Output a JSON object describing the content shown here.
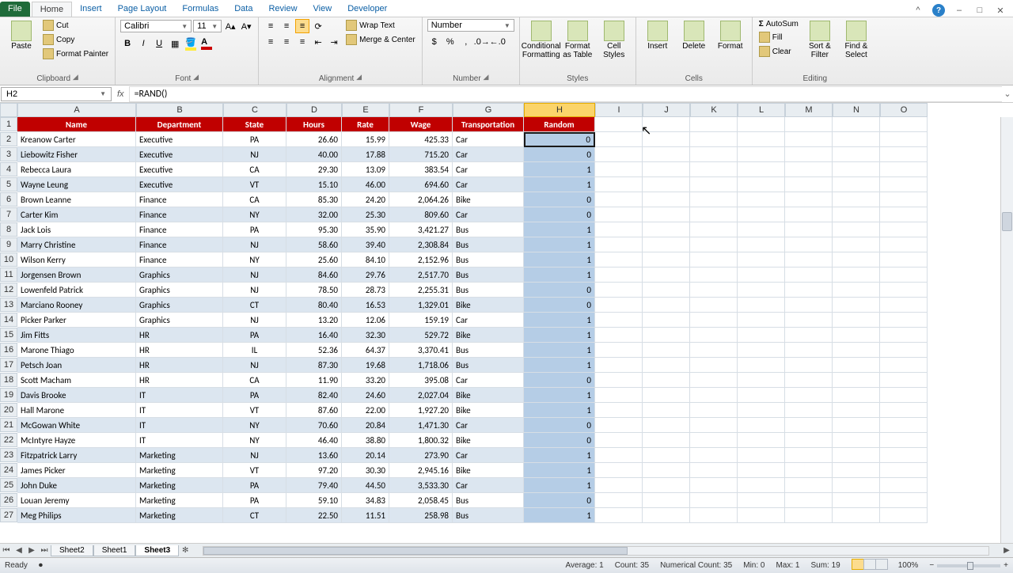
{
  "tabs": [
    "File",
    "Home",
    "Insert",
    "Page Layout",
    "Formulas",
    "Data",
    "Review",
    "View",
    "Developer"
  ],
  "active_tab": "Home",
  "clipboard": {
    "paste": "Paste",
    "cut": "Cut",
    "copy": "Copy",
    "painter": "Format Painter",
    "group": "Clipboard"
  },
  "font": {
    "name": "Calibri",
    "size": "11",
    "group": "Font"
  },
  "alignment": {
    "wrap": "Wrap Text",
    "merge": "Merge & Center",
    "group": "Alignment"
  },
  "number": {
    "format": "Number",
    "group": "Number"
  },
  "styles": {
    "cond": "Conditional Formatting",
    "tbl": "Format as Table",
    "cell": "Cell Styles",
    "group": "Styles"
  },
  "cells": {
    "insert": "Insert",
    "delete": "Delete",
    "format": "Format",
    "group": "Cells"
  },
  "editing": {
    "sum": "AutoSum",
    "fill": "Fill",
    "clear": "Clear",
    "sort": "Sort & Filter",
    "find": "Find & Select",
    "group": "Editing"
  },
  "namebox": "H2",
  "formula": "=RAND()",
  "columns": [
    "A",
    "B",
    "C",
    "D",
    "E",
    "F",
    "G",
    "H",
    "I",
    "J",
    "K",
    "L",
    "M",
    "N",
    "O"
  ],
  "selected_col_idx": 7,
  "headers": [
    "Name",
    "Department",
    "State",
    "Hours",
    "Rate",
    "Wage",
    "Transportation",
    "Random"
  ],
  "rows": [
    {
      "n": 2,
      "d": [
        "Kreanow Carter",
        "Executive",
        "PA",
        "26.60",
        "15.99",
        "425.33",
        "Car",
        "0"
      ]
    },
    {
      "n": 3,
      "d": [
        "Liebowitz Fisher",
        "Executive",
        "NJ",
        "40.00",
        "17.88",
        "715.20",
        "Car",
        "0"
      ]
    },
    {
      "n": 4,
      "d": [
        "Rebecca Laura",
        "Executive",
        "CA",
        "29.30",
        "13.09",
        "383.54",
        "Car",
        "1"
      ]
    },
    {
      "n": 5,
      "d": [
        "Wayne Leung",
        "Executive",
        "VT",
        "15.10",
        "46.00",
        "694.60",
        "Car",
        "1"
      ]
    },
    {
      "n": 6,
      "d": [
        "Brown Leanne",
        "Finance",
        "CA",
        "85.30",
        "24.20",
        "2,064.26",
        "Bike",
        "0"
      ]
    },
    {
      "n": 7,
      "d": [
        "Carter Kim",
        "Finance",
        "NY",
        "32.00",
        "25.30",
        "809.60",
        "Car",
        "0"
      ]
    },
    {
      "n": 8,
      "d": [
        "Jack Lois",
        "Finance",
        "PA",
        "95.30",
        "35.90",
        "3,421.27",
        "Bus",
        "1"
      ]
    },
    {
      "n": 9,
      "d": [
        "Marry Christine",
        "Finance",
        "NJ",
        "58.60",
        "39.40",
        "2,308.84",
        "Bus",
        "1"
      ]
    },
    {
      "n": 10,
      "d": [
        "Wilson Kerry",
        "Finance",
        "NY",
        "25.60",
        "84.10",
        "2,152.96",
        "Bus",
        "1"
      ]
    },
    {
      "n": 11,
      "d": [
        "Jorgensen Brown",
        "Graphics",
        "NJ",
        "84.60",
        "29.76",
        "2,517.70",
        "Bus",
        "1"
      ]
    },
    {
      "n": 12,
      "d": [
        "Lowenfeld Patrick",
        "Graphics",
        "NJ",
        "78.50",
        "28.73",
        "2,255.31",
        "Bus",
        "0"
      ]
    },
    {
      "n": 13,
      "d": [
        "Marciano Rooney",
        "Graphics",
        "CT",
        "80.40",
        "16.53",
        "1,329.01",
        "Bike",
        "0"
      ]
    },
    {
      "n": 14,
      "d": [
        "Picker Parker",
        "Graphics",
        "NJ",
        "13.20",
        "12.06",
        "159.19",
        "Car",
        "1"
      ]
    },
    {
      "n": 15,
      "d": [
        "Jim Fitts",
        "HR",
        "PA",
        "16.40",
        "32.30",
        "529.72",
        "Bike",
        "1"
      ]
    },
    {
      "n": 16,
      "d": [
        "Marone Thiago",
        "HR",
        "IL",
        "52.36",
        "64.37",
        "3,370.41",
        "Bus",
        "1"
      ]
    },
    {
      "n": 17,
      "d": [
        "Petsch Joan",
        "HR",
        "NJ",
        "87.30",
        "19.68",
        "1,718.06",
        "Bus",
        "1"
      ]
    },
    {
      "n": 18,
      "d": [
        "Scott Macham",
        "HR",
        "CA",
        "11.90",
        "33.20",
        "395.08",
        "Car",
        "0"
      ]
    },
    {
      "n": 19,
      "d": [
        "Davis Brooke",
        "IT",
        "PA",
        "82.40",
        "24.60",
        "2,027.04",
        "Bike",
        "1"
      ]
    },
    {
      "n": 20,
      "d": [
        "Hall Marone",
        "IT",
        "VT",
        "87.60",
        "22.00",
        "1,927.20",
        "Bike",
        "1"
      ]
    },
    {
      "n": 21,
      "d": [
        "McGowan White",
        "IT",
        "NY",
        "70.60",
        "20.84",
        "1,471.30",
        "Car",
        "0"
      ]
    },
    {
      "n": 22,
      "d": [
        "McIntyre Hayze",
        "IT",
        "NY",
        "46.40",
        "38.80",
        "1,800.32",
        "Bike",
        "0"
      ]
    },
    {
      "n": 23,
      "d": [
        "Fitzpatrick Larry",
        "Marketing",
        "NJ",
        "13.60",
        "20.14",
        "273.90",
        "Car",
        "1"
      ]
    },
    {
      "n": 24,
      "d": [
        "James Picker",
        "Marketing",
        "VT",
        "97.20",
        "30.30",
        "2,945.16",
        "Bike",
        "1"
      ]
    },
    {
      "n": 25,
      "d": [
        "John Duke",
        "Marketing",
        "PA",
        "79.40",
        "44.50",
        "3,533.30",
        "Car",
        "1"
      ]
    },
    {
      "n": 26,
      "d": [
        "Louan Jeremy",
        "Marketing",
        "PA",
        "59.10",
        "34.83",
        "2,058.45",
        "Bus",
        "0"
      ]
    },
    {
      "n": 27,
      "d": [
        "Meg Philips",
        "Marketing",
        "CT",
        "22.50",
        "11.51",
        "258.98",
        "Bus",
        "1"
      ]
    }
  ],
  "num_cols": [
    3,
    4,
    5,
    7
  ],
  "center_cols": [
    2
  ],
  "sheets": [
    "Sheet2",
    "Sheet1",
    "Sheet3"
  ],
  "active_sheet": "Sheet3",
  "status": {
    "ready": "Ready",
    "avg": "Average: 1",
    "count": "Count: 35",
    "numcount": "Numerical Count: 35",
    "min": "Min: 0",
    "max": "Max: 1",
    "sum": "Sum: 19",
    "zoom": "100%"
  }
}
